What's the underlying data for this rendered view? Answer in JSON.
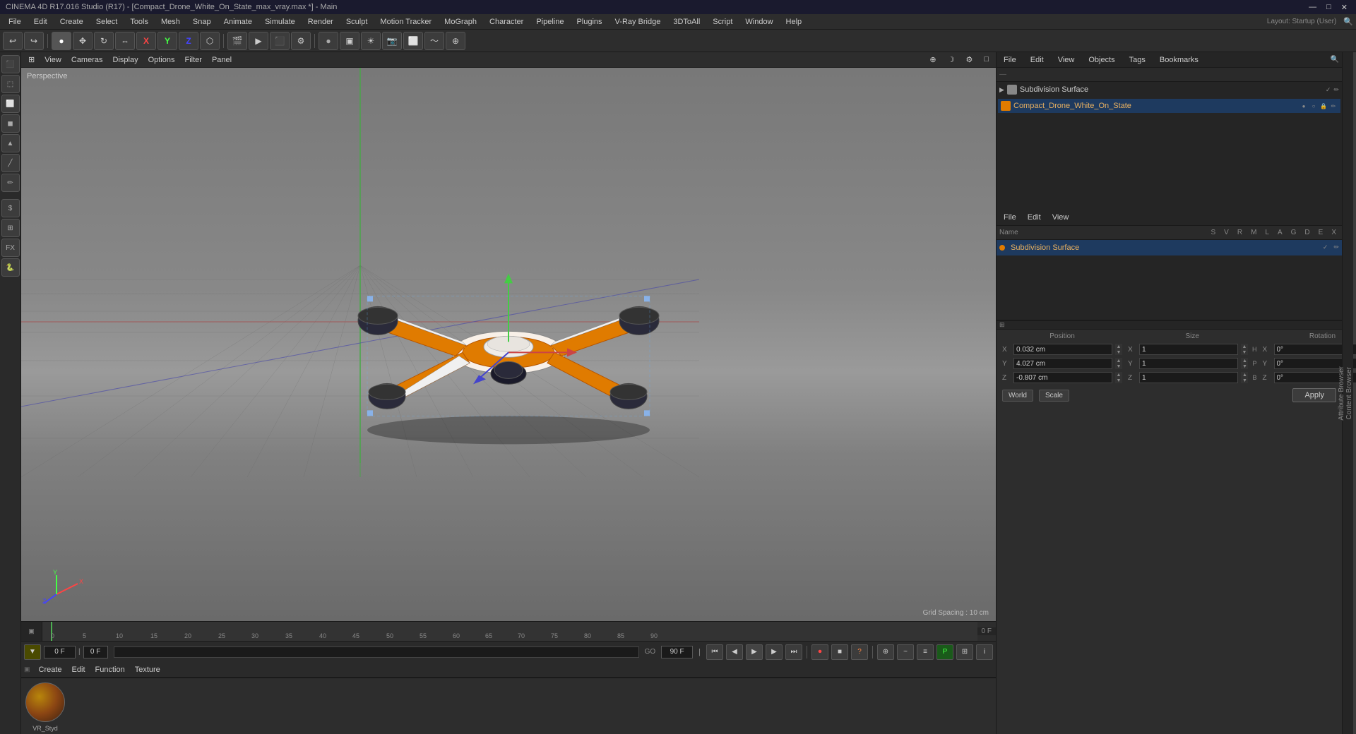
{
  "titlebar": {
    "title": "CINEMA 4D R17.016 Studio (R17) - [Compact_Drone_White_On_State_max_vray.max *] - Main",
    "controls": [
      "—",
      "□",
      "✕"
    ]
  },
  "menubar": {
    "items": [
      "File",
      "Edit",
      "Create",
      "Select",
      "Tools",
      "Mesh",
      "Snap",
      "Animate",
      "Simulate",
      "Render",
      "Sculpt",
      "Motion Tracker",
      "MoGraph",
      "Character",
      "Pipeline",
      "Plugins",
      "V-Ray Bridge",
      "3DToAll",
      "Script",
      "Window",
      "Help"
    ]
  },
  "toolbar": {
    "undo_label": "↩",
    "layout_label": "Layout: Startup (User)"
  },
  "viewport": {
    "perspective_label": "Perspective",
    "grid_spacing_label": "Grid Spacing : 10 cm",
    "menu_items": [
      "View",
      "Cameras",
      "Display",
      "Options",
      "Filter",
      "Panel"
    ]
  },
  "timeline": {
    "ticks": [
      "0",
      "5",
      "10",
      "15",
      "20",
      "25",
      "30",
      "35",
      "40",
      "45",
      "50",
      "55",
      "60",
      "65",
      "70",
      "75",
      "80",
      "85",
      "90"
    ],
    "current_frame": "0 F",
    "end_frame": "90 F",
    "start_frame": "0 F"
  },
  "transport": {
    "frame_current": "0 F",
    "frame_end": "90 F",
    "frame_start": "0 F"
  },
  "material_bar": {
    "menu": [
      "Create",
      "Edit",
      "Function",
      "Texture"
    ],
    "material_name": "VR_Styd"
  },
  "object_manager": {
    "header_items": [
      "File",
      "Edit",
      "View",
      "Objects",
      "Tags",
      "Bookmarks"
    ],
    "objects": [
      {
        "name": "Subdivision Surface",
        "icon_color": "#888",
        "selected": false
      },
      {
        "name": "Compact_Drone_White_On_State",
        "icon_color": "#e07b00",
        "selected": true
      }
    ]
  },
  "attributes_panel": {
    "header_items": [
      "File",
      "Edit",
      "View"
    ],
    "columns": [
      "Name",
      "S",
      "V",
      "R",
      "M",
      "L",
      "A",
      "G",
      "D",
      "E",
      "X"
    ]
  },
  "coord_panel": {
    "position_header": "Position",
    "size_header": "Size",
    "rotation_header": "Rotation",
    "x_pos": "0.032 cm",
    "y_pos": "4.027 cm",
    "z_pos": "-0.807 cm",
    "x_size": "1",
    "y_size": "1",
    "z_size": "1",
    "x_rot": "0°",
    "y_rot": "0°",
    "z_rot": "0°",
    "mode_world": "World",
    "mode_scale": "Scale",
    "apply_label": "Apply"
  },
  "content_browser": {
    "label1": "Content Browser",
    "label2": "Attribute Browser"
  },
  "icons": {
    "search": "🔍",
    "gear": "⚙",
    "cube": "▣",
    "sphere": "○",
    "cylinder": "◎",
    "light": "☀",
    "camera": "📷",
    "move": "✥",
    "rotate": "↻",
    "scale": "⇔",
    "axis_x": "X",
    "axis_y": "Y",
    "axis_z": "Z",
    "play": "▶",
    "stop": "■",
    "prev": "◀",
    "next": "▶",
    "first": "⏮",
    "last": "⏭",
    "record": "⏺"
  }
}
